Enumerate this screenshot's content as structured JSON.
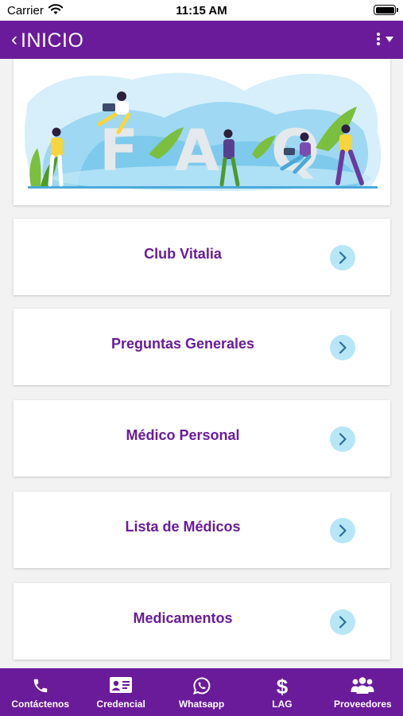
{
  "status_bar": {
    "carrier": "Carrier",
    "time": "11:15 AM"
  },
  "app_bar": {
    "back_glyph": "‹",
    "title": "INICIO"
  },
  "hero": {
    "letters": [
      "F",
      "A",
      "Q"
    ]
  },
  "faq_items": [
    {
      "label": "Club Vitalia"
    },
    {
      "label": "Preguntas Generales"
    },
    {
      "label": "Médico Personal"
    },
    {
      "label": "Lista de Médicos"
    },
    {
      "label": "Medicamentos"
    }
  ],
  "bottom_nav": [
    {
      "label": "Contáctenos",
      "icon": "phone-icon"
    },
    {
      "label": "Credencial",
      "icon": "id-card-icon"
    },
    {
      "label": "Whatsapp",
      "icon": "whatsapp-icon"
    },
    {
      "label": "LAG",
      "icon": "dollar-icon",
      "glyph": "$"
    },
    {
      "label": "Proveedores",
      "icon": "people-icon"
    }
  ],
  "colors": {
    "primary": "#6a1b9a",
    "chevron_bg": "#b7e6f7",
    "chevron_fg": "#2b6f9c",
    "background": "#f2f2f2"
  }
}
